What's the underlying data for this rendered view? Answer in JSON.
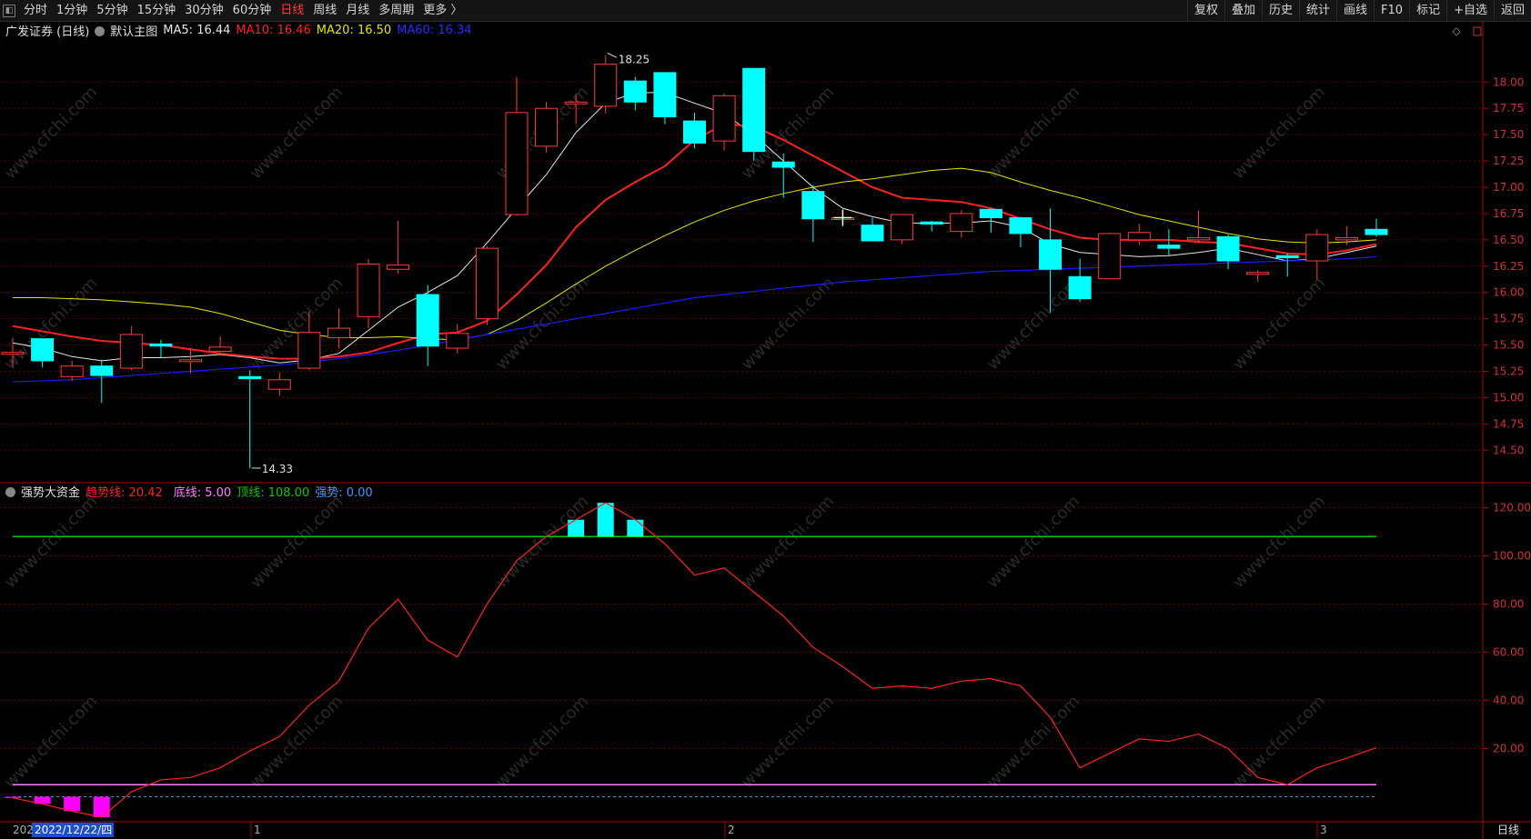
{
  "toolbar": {
    "left": [
      "分时",
      "1分钟",
      "5分钟",
      "15分钟",
      "30分钟",
      "60分钟",
      "日线",
      "周线",
      "月线",
      "多周期",
      "更多 〉"
    ],
    "active": "日线",
    "right": [
      "复权",
      "叠加",
      "历史",
      "统计",
      "画线",
      "F10",
      "+自选",
      "返回"
    ],
    "mark": "标记"
  },
  "main_legend": {
    "title": "广发证券 (日线)",
    "template": "默认主图",
    "ma5": "MA5: 16.44",
    "ma10": "MA10: 16.46",
    "ma20": "MA20: 16.50",
    "ma60": "MA60: 16.34"
  },
  "sub_legend": {
    "title": "强势大资金",
    "trend": "趋势线: 20.42",
    "bottom": "底线: 5.00",
    "top": "顶线: 108.00",
    "strong": "强势: 0.00"
  },
  "footer": {
    "date_cursor": "2022/12/22/四",
    "date_prefix": "202",
    "month_marks": [
      "1",
      "2",
      "3"
    ],
    "period": "日线"
  },
  "watermark": "www.cfchi.com",
  "colors": {
    "up": "#ff3b3b",
    "down": "#00ffff",
    "ma5": "#e8e8e8",
    "ma10": "#ff2020",
    "ma20": "#e5e500",
    "ma60": "#1a1aff",
    "top_line": "#00c800",
    "bottom_line": "#ff80ff",
    "trend": "#ff2020",
    "axis": "#b00000",
    "grid": "#5a0000"
  },
  "chart_data": [
    {
      "type": "candlestick",
      "title": "广发证券 (日线)",
      "y_ticks": [
        14.5,
        14.75,
        15.0,
        15.25,
        15.5,
        15.75,
        16.0,
        16.25,
        16.5,
        16.75,
        17.0,
        17.25,
        17.5,
        17.75,
        18.0
      ],
      "ylim": [
        14.2,
        18.4
      ],
      "annotations": {
        "high": "18.25",
        "low": "14.33"
      },
      "candles": [
        {
          "o": 15.43,
          "h": 15.57,
          "l": 15.3,
          "c": 15.43
        },
        {
          "o": 15.56,
          "h": 15.56,
          "l": 15.29,
          "c": 15.35
        },
        {
          "o": 15.2,
          "h": 15.35,
          "l": 15.16,
          "c": 15.3
        },
        {
          "o": 15.3,
          "h": 15.36,
          "l": 14.95,
          "c": 15.21
        },
        {
          "o": 15.28,
          "h": 15.68,
          "l": 15.26,
          "c": 15.6
        },
        {
          "o": 15.51,
          "h": 15.55,
          "l": 15.38,
          "c": 15.49
        },
        {
          "o": 15.36,
          "h": 15.47,
          "l": 15.23,
          "c": 15.36
        },
        {
          "o": 15.44,
          "h": 15.58,
          "l": 15.4,
          "c": 15.48
        },
        {
          "o": 15.2,
          "h": 15.26,
          "l": 14.33,
          "c": 15.18
        },
        {
          "o": 15.08,
          "h": 15.24,
          "l": 15.02,
          "c": 15.17
        },
        {
          "o": 15.28,
          "h": 15.82,
          "l": 15.26,
          "c": 15.62
        },
        {
          "o": 15.57,
          "h": 15.85,
          "l": 15.47,
          "c": 15.66
        },
        {
          "o": 15.77,
          "h": 16.32,
          "l": 15.66,
          "c": 16.27
        },
        {
          "o": 16.22,
          "h": 16.68,
          "l": 16.18,
          "c": 16.26
        },
        {
          "o": 15.98,
          "h": 16.07,
          "l": 15.3,
          "c": 15.49
        },
        {
          "o": 15.47,
          "h": 15.7,
          "l": 15.42,
          "c": 15.61
        },
        {
          "o": 15.75,
          "h": 16.44,
          "l": 15.69,
          "c": 16.42
        },
        {
          "o": 16.74,
          "h": 18.05,
          "l": 16.73,
          "c": 17.71
        },
        {
          "o": 17.39,
          "h": 17.81,
          "l": 17.33,
          "c": 17.75
        },
        {
          "o": 17.8,
          "h": 17.88,
          "l": 17.6,
          "c": 17.81
        },
        {
          "o": 17.77,
          "h": 18.25,
          "l": 17.7,
          "c": 18.17
        },
        {
          "o": 18.01,
          "h": 18.05,
          "l": 17.73,
          "c": 17.81
        },
        {
          "o": 18.09,
          "h": 18.09,
          "l": 17.6,
          "c": 17.67
        },
        {
          "o": 17.63,
          "h": 17.71,
          "l": 17.37,
          "c": 17.42
        },
        {
          "o": 17.44,
          "h": 17.89,
          "l": 17.35,
          "c": 17.87
        },
        {
          "o": 18.13,
          "h": 18.13,
          "l": 17.25,
          "c": 17.34
        },
        {
          "o": 17.24,
          "h": 17.32,
          "l": 16.9,
          "c": 17.19
        },
        {
          "o": 16.96,
          "h": 17.02,
          "l": 16.48,
          "c": 16.7
        },
        {
          "o": 16.7,
          "h": 16.75,
          "l": 16.7,
          "c": 16.71
        },
        {
          "o": 16.64,
          "h": 16.71,
          "l": 16.5,
          "c": 16.49
        },
        {
          "o": 16.5,
          "h": 16.73,
          "l": 16.46,
          "c": 16.74
        },
        {
          "o": 16.67,
          "h": 16.68,
          "l": 16.58,
          "c": 16.65
        },
        {
          "o": 16.58,
          "h": 16.78,
          "l": 16.52,
          "c": 16.75
        },
        {
          "o": 16.79,
          "h": 16.8,
          "l": 16.57,
          "c": 16.71
        },
        {
          "o": 16.71,
          "h": 16.72,
          "l": 16.43,
          "c": 16.56
        },
        {
          "o": 16.5,
          "h": 16.8,
          "l": 15.81,
          "c": 16.22
        },
        {
          "o": 16.15,
          "h": 16.32,
          "l": 15.91,
          "c": 15.94
        },
        {
          "o": 16.13,
          "h": 16.57,
          "l": 16.13,
          "c": 16.56
        },
        {
          "o": 16.5,
          "h": 16.65,
          "l": 16.45,
          "c": 16.57
        },
        {
          "o": 16.45,
          "h": 16.6,
          "l": 16.35,
          "c": 16.42
        },
        {
          "o": 16.5,
          "h": 16.78,
          "l": 16.47,
          "c": 16.52
        },
        {
          "o": 16.53,
          "h": 16.55,
          "l": 16.22,
          "c": 16.3
        },
        {
          "o": 16.18,
          "h": 16.21,
          "l": 16.1,
          "c": 16.19
        },
        {
          "o": 16.35,
          "h": 16.37,
          "l": 16.15,
          "c": 16.33
        },
        {
          "o": 16.3,
          "h": 16.6,
          "l": 16.12,
          "c": 16.55
        },
        {
          "o": 16.5,
          "h": 16.63,
          "l": 16.45,
          "c": 16.52
        },
        {
          "o": 16.6,
          "h": 16.7,
          "l": 16.53,
          "c": 16.55
        }
      ],
      "series": [
        {
          "name": "MA5",
          "values": [
            15.52,
            15.47,
            15.39,
            15.35,
            15.38,
            15.38,
            15.39,
            15.41,
            15.38,
            15.33,
            15.36,
            15.42,
            15.64,
            15.86,
            16.0,
            16.16,
            16.47,
            16.8,
            17.12,
            17.52,
            17.8,
            17.9,
            17.9,
            17.8,
            17.7,
            17.5,
            17.25,
            17.0,
            16.8,
            16.72,
            16.66,
            16.66,
            16.66,
            16.68,
            16.62,
            16.46,
            16.38,
            16.36,
            16.34,
            16.35,
            16.38,
            16.42,
            16.36,
            16.3,
            16.32,
            16.38,
            16.44
          ]
        },
        {
          "name": "MA10",
          "values": [
            15.68,
            15.63,
            15.58,
            15.54,
            15.52,
            15.5,
            15.46,
            15.42,
            15.39,
            15.37,
            15.37,
            15.39,
            15.43,
            15.52,
            15.6,
            15.62,
            15.73,
            15.98,
            16.26,
            16.62,
            16.88,
            17.05,
            17.2,
            17.45,
            17.6,
            17.58,
            17.45,
            17.3,
            17.15,
            17.0,
            16.9,
            16.88,
            16.86,
            16.8,
            16.7,
            16.6,
            16.52,
            16.5,
            16.5,
            16.5,
            16.48,
            16.47,
            16.42,
            16.37,
            16.36,
            16.4,
            16.46
          ]
        },
        {
          "name": "MA20",
          "values": [
            15.95,
            15.95,
            15.94,
            15.93,
            15.91,
            15.89,
            15.86,
            15.8,
            15.72,
            15.64,
            15.6,
            15.57,
            15.57,
            15.58,
            15.56,
            15.55,
            15.6,
            15.73,
            15.9,
            16.08,
            16.25,
            16.4,
            16.54,
            16.67,
            16.78,
            16.87,
            16.94,
            17.0,
            17.05,
            17.08,
            17.12,
            17.16,
            17.18,
            17.14,
            17.05,
            16.97,
            16.9,
            16.82,
            16.74,
            16.68,
            16.62,
            16.56,
            16.51,
            16.48,
            16.47,
            16.48,
            16.5
          ]
        },
        {
          "name": "MA60",
          "values": [
            15.15,
            15.16,
            15.17,
            15.19,
            15.21,
            15.23,
            15.25,
            15.27,
            15.29,
            15.31,
            15.34,
            15.37,
            15.41,
            15.45,
            15.5,
            15.55,
            15.6,
            15.65,
            15.7,
            15.75,
            15.8,
            15.85,
            15.9,
            15.95,
            15.98,
            16.01,
            16.04,
            16.07,
            16.1,
            16.12,
            16.14,
            16.16,
            16.18,
            16.2,
            16.21,
            16.22,
            16.23,
            16.24,
            16.25,
            16.26,
            16.27,
            16.28,
            16.29,
            16.3,
            16.31,
            16.32,
            16.34
          ]
        }
      ]
    },
    {
      "type": "line",
      "title": "强势大资金",
      "y_ticks": [
        20,
        40,
        60,
        80,
        100,
        120
      ],
      "ylim": [
        -10,
        130
      ],
      "series": [
        {
          "name": "趋势线",
          "values": [
            -0.5,
            -3,
            -6,
            -8.5,
            2,
            7,
            8,
            12,
            19,
            25,
            38,
            48,
            70,
            82,
            65,
            58,
            80,
            98,
            108,
            115,
            122,
            115,
            105,
            92,
            95,
            85,
            75,
            62,
            54,
            45,
            46,
            45,
            48,
            49,
            46,
            33,
            12,
            18,
            24,
            23,
            26,
            20,
            8,
            5,
            12,
            16,
            20.42
          ]
        },
        {
          "name": "顶线",
          "values": [
            108
          ]
        },
        {
          "name": "底线",
          "values": [
            5
          ]
        }
      ],
      "bars_positive_indices": [
        18,
        19,
        20,
        21
      ],
      "bars_negative_indices": [
        0,
        1,
        2,
        3
      ]
    }
  ]
}
